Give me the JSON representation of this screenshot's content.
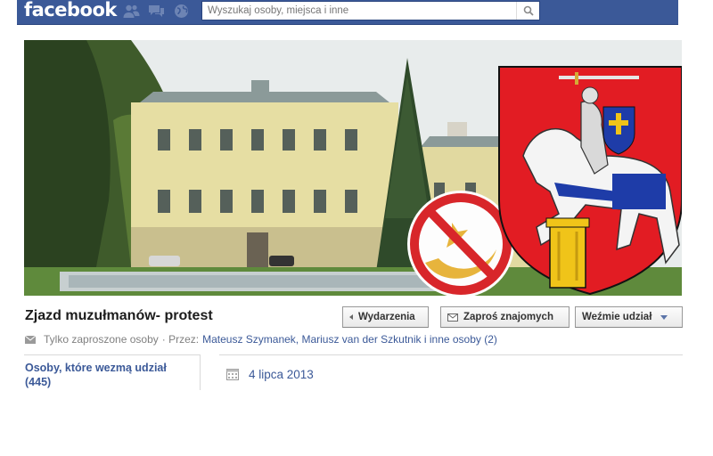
{
  "header": {
    "logo": "facebook",
    "icons": [
      "friend-requests-icon",
      "messages-icon",
      "notifications-globe-icon"
    ],
    "search_placeholder": "Wyszukaj osoby, miejsca i inne",
    "colors": {
      "bar": "#3b5998"
    }
  },
  "cover": {
    "image": "palace-photo-with-coat-of-arms"
  },
  "event": {
    "title": "Zjazd muzułmanów- protest",
    "buttons": {
      "events": "Wydarzenia",
      "invite": "Zaproś znajomych",
      "join": "Weźmie udział"
    },
    "privacy": "Tylko zaproszone osoby",
    "by_label": "· Przez:",
    "hosts": "Mateusz Szymanek, Mariusz van der Szkutnik i inne osoby (2)",
    "guests_label": "Osoby, które wezmą udział (445)",
    "date": "4 lipca 2013"
  }
}
